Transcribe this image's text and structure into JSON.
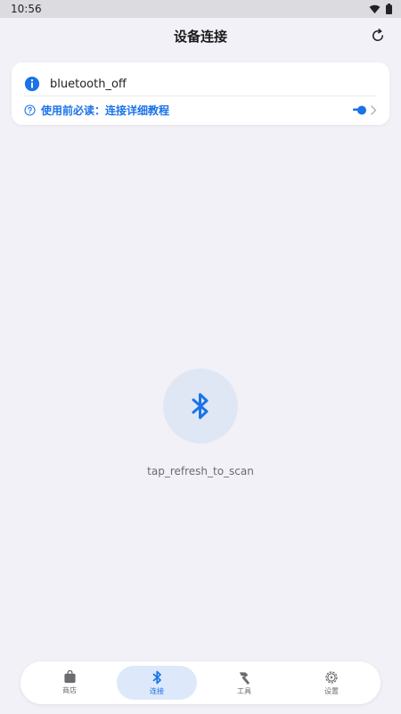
{
  "status_bar": {
    "time": "10:56"
  },
  "header": {
    "title": "设备连接"
  },
  "info_card": {
    "message": "bluetooth_off",
    "guide_text": "使用前必读：连接详细教程"
  },
  "empty_state": {
    "hint": "tap_refresh_to_scan"
  },
  "bottom_nav": {
    "items": [
      {
        "label": "商店",
        "icon": "store-bag-icon"
      },
      {
        "label": "连接",
        "icon": "bluetooth-icon"
      },
      {
        "label": "工具",
        "icon": "hammer-icon"
      },
      {
        "label": "设置",
        "icon": "settings-gear-icon"
      }
    ],
    "active_index": 1
  },
  "colors": {
    "accent": "#1a73e8",
    "background": "#f2f1f7",
    "active_pill": "#dde8fa"
  }
}
